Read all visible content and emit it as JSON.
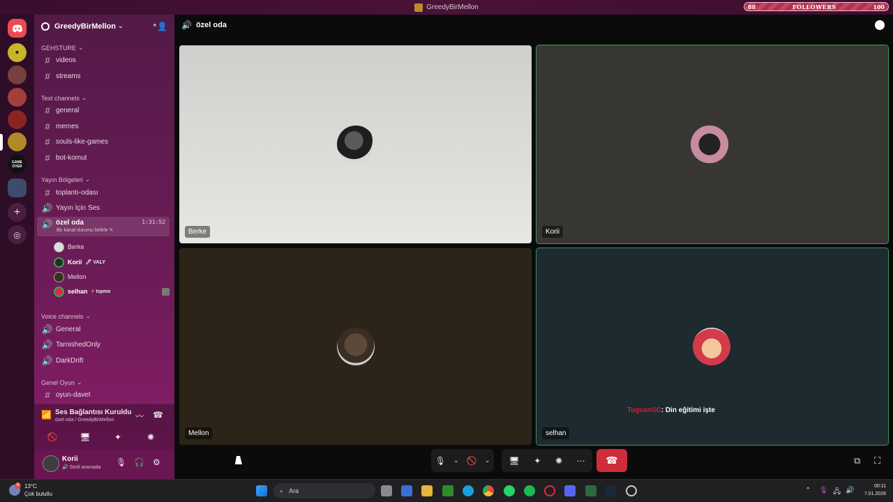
{
  "window": {
    "title": "GreedyBirMellon",
    "followers_left": "88",
    "followers_label": "FOLLOWERS",
    "followers_right": "100"
  },
  "rail": {
    "servers": [
      {
        "name": "home",
        "color": "#ea4b55"
      },
      {
        "name": "server-1",
        "color": "#c7b52a"
      },
      {
        "name": "server-2",
        "color": "#7a4040"
      },
      {
        "name": "server-3",
        "color": "#a53d3d"
      },
      {
        "name": "server-4",
        "color": "#8c2323"
      },
      {
        "name": "server-5",
        "color": "#b08a2a"
      },
      {
        "name": "server-6",
        "color": "#111111",
        "text": "GAME OVER"
      },
      {
        "name": "server-7",
        "color": "#3c4c6a"
      }
    ]
  },
  "sidebar": {
    "guild_name": "GreedyBirMellon",
    "categories": [
      {
        "label": "GEHSTURE"
      },
      {
        "label": "Text channels"
      },
      {
        "label": "Yayın Bölgeleri"
      },
      {
        "label": "Voice channels"
      },
      {
        "label": "Genel Oyun"
      }
    ],
    "channels": [
      {
        "label": "videos",
        "kind": "text"
      },
      {
        "label": "streams",
        "kind": "text"
      },
      {
        "label": "general",
        "kind": "text"
      },
      {
        "label": "memes",
        "kind": "text"
      },
      {
        "label": "souls-like-games",
        "kind": "text"
      },
      {
        "label": "bot-komut",
        "kind": "text"
      },
      {
        "label": "toplantı-odası",
        "kind": "text"
      },
      {
        "label": "Yayın İçin Ses",
        "kind": "voice"
      },
      {
        "label": "özel oda",
        "kind": "voice",
        "time": "1:31:52",
        "status": "Bir kanal durumu belirle"
      },
      {
        "label": "General",
        "kind": "voice"
      },
      {
        "label": "TarnishedOnly",
        "kind": "voice"
      },
      {
        "label": "DarkDrift",
        "kind": "voice"
      },
      {
        "label": "oyun-davet",
        "kind": "text"
      }
    ],
    "voice_users": [
      {
        "name": "Berke",
        "tag": ""
      },
      {
        "name": "Korii",
        "tag": "VALY"
      },
      {
        "name": "Mellon",
        "tag": ""
      },
      {
        "name": "selhan",
        "tag": "tspmo"
      }
    ]
  },
  "voice_panel": {
    "status": "Ses Bağlantısı Kuruldu",
    "location": "özel oda / GreedyBirMellon"
  },
  "user_panel": {
    "name": "Korii",
    "status": "Sesli aramada"
  },
  "main": {
    "channel_title": "özel oda",
    "tiles": [
      {
        "name": "Berke",
        "bg": "#dcdcd9",
        "speaking": false
      },
      {
        "name": "Korii",
        "bg": "#383633",
        "speaking": true
      },
      {
        "name": "Mellon",
        "bg": "#2c2418",
        "speaking": false
      },
      {
        "name": "selhan",
        "bg": "#1d2a30",
        "speaking": true
      }
    ],
    "caption_user": "TugcanSC",
    "caption_text": ": Din eğitimi işte"
  },
  "taskbar": {
    "temp": "13°C",
    "weather": "Çok bulutlu",
    "search_placeholder": "Ara",
    "time": "00:11",
    "date": "7.01.2026",
    "weather_badge": "6"
  }
}
